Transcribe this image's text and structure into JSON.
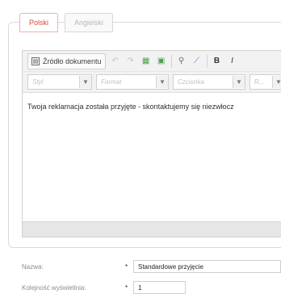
{
  "tabs": [
    {
      "label": "Polski"
    },
    {
      "label": "Angielski"
    }
  ],
  "editor": {
    "toolbar_row1": {
      "source_button": "Źródło dokumentu",
      "icons": [
        "undo-icon",
        "redo-icon",
        "copy-icon",
        "paste-icon",
        "find-icon",
        "eraser-icon",
        "bold-icon",
        "italic-icon"
      ],
      "bold_glyph": "B",
      "italic_glyph": "I"
    },
    "toolbar_row2": {
      "combos": [
        "Styl",
        "Format",
        "Czcionka",
        "R..."
      ]
    },
    "content_text": "Twoja reklamacja została przyjęte - skontaktujemy się niezwłocz"
  },
  "form": {
    "name_label": "Nazwa:",
    "name_value": "Standardowe przyjęcie",
    "order_label": "Kolejność wyświetlnia:",
    "order_value": "1",
    "required_marker": "*"
  },
  "colors": {
    "active_tab": "#d94a38",
    "inactive_tab": "#b8b8b8"
  }
}
